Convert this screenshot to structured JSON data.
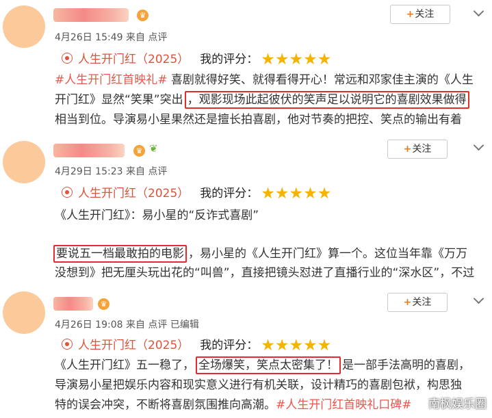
{
  "posts": [
    {
      "meta": "4月26日 15:49 来自 点评",
      "follow_label": "关注",
      "movie_title": "人生开门红（2025）",
      "rating_label": "我的评分：",
      "stars": "★★★★★",
      "rating": 5,
      "lines": [
        {
          "tag": "#人生开门红首映礼#",
          "text": " 喜剧就得好笑、就得看得开心！常远和邓家佳主演的《人生"
        },
        {
          "pre": "开门红》显然“笑果”突出",
          "boxed": "，观影现场此起彼伏的笑声足以说明它的喜剧效果做得"
        },
        {
          "text": "相当到位。导演易小星果然还是擅长拍喜剧，他对节奏的把控、笑点的输出有着"
        }
      ]
    },
    {
      "meta": "4月29日 15:23 来自 点评",
      "follow_label": "关注",
      "movie_title": "人生开门红（2025）",
      "rating_label": "我的评分：",
      "stars": "★★★★★",
      "rating": 5,
      "lines": [
        {
          "text": "《人生开门红》：易小星的“反诈式喜剧”"
        },
        {
          "boxed": "要说五一档最敢拍的电影",
          "post": "，易小星的《人生开门红》算一个。这位当年靠《万万"
        },
        {
          "text": "没想到》把无厘头玩出花的“叫兽”，直接把镜头怼进了直播行业的“深水区”，不过"
        }
      ]
    },
    {
      "meta": "4月26日 19:08 来自 点评  已编辑",
      "follow_label": "关注",
      "movie_title": "人生开门红（2025）",
      "rating_label": "我的评分：",
      "stars": "★★★★★",
      "rating": 5,
      "lines": [
        {
          "pre": "《人生开门红》五一稳了，",
          "boxed": "全场爆笑，笑点太密集了！",
          "post": "是一部手法高明的喜剧，"
        },
        {
          "text": "导演易小星把娱乐内容和现实意义进行有机关联，设计精巧的喜剧包袱，构思独"
        },
        {
          "text": "特的误会冲突，不断将喜剧氛围推向高潮。",
          "tag": "#人生开门红首映礼口碑#"
        }
      ]
    }
  ],
  "watermark": "南枫娱乐圈",
  "colors": {
    "accent": "#e8564d",
    "box": "#e52a2a",
    "star": "#f5b400",
    "avatar": "#fbc99a"
  },
  "icons": [
    "crown-badge-icon",
    "sprout-icon",
    "film-reel-icon",
    "plus-icon",
    "chevron-down-icon"
  ]
}
